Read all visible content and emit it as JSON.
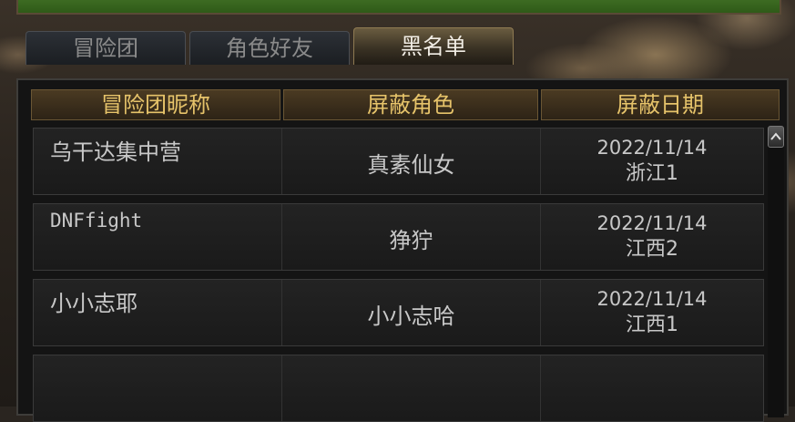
{
  "tabs": [
    {
      "label": "冒险团",
      "active": false
    },
    {
      "label": "角色好友",
      "active": false
    },
    {
      "label": "黑名单",
      "active": true
    }
  ],
  "table": {
    "headers": [
      "冒险团昵称",
      "屏蔽角色",
      "屏蔽日期"
    ],
    "rows": [
      {
        "adventure_name": "乌干达集中营",
        "role": "真素仙女",
        "date": "2022/11/14",
        "server": "浙江1"
      },
      {
        "adventure_name": "DNFfight",
        "role": "狰狞",
        "date": "2022/11/14",
        "server": "江西2"
      },
      {
        "adventure_name": "小小志耶",
        "role": "小小志哈",
        "date": "2022/11/14",
        "server": "江西1"
      },
      {
        "adventure_name": "",
        "role": "",
        "date": "",
        "server": ""
      }
    ]
  },
  "scrollbar": {
    "up_icon": "chevron-up-icon"
  },
  "colors": {
    "header_text": "#e6c36a",
    "cell_text": "#c8c8c8",
    "top_bar": "#3d6b22"
  }
}
